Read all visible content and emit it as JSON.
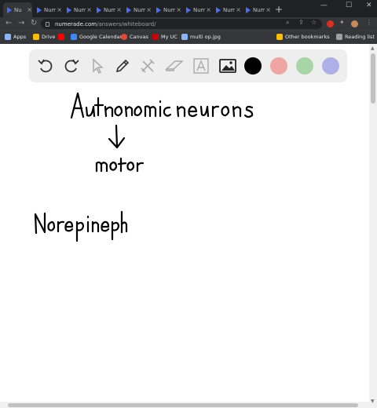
{
  "browser": {
    "tabs": [
      {
        "label": "Nu",
        "active": true
      },
      {
        "label": "Nume"
      },
      {
        "label": "Nume"
      },
      {
        "label": "Nume"
      },
      {
        "label": "Nume"
      },
      {
        "label": "Nume"
      },
      {
        "label": "Nume"
      },
      {
        "label": "Nume"
      },
      {
        "label": "Nume"
      }
    ],
    "new_tab_label": "+",
    "url_host": "numerade.com",
    "url_path": "/answers/whiteboard/",
    "bookmarks": [
      {
        "label": "Apps",
        "color": "#8ab4f8"
      },
      {
        "label": "Drive",
        "color": "#fbbc04"
      },
      {
        "label": "",
        "color": "#ff0000"
      },
      {
        "label": "Google Calendar",
        "color": "#4285f4"
      },
      {
        "label": "Canvas",
        "color": "#e34935"
      },
      {
        "label": "My UC",
        "color": "#c5050c"
      },
      {
        "label": "multi op.jpg",
        "color": "#8ab4f8"
      }
    ],
    "other_bookmarks": "Other bookmarks",
    "reading_list": "Reading list"
  },
  "whiteboard": {
    "tools": [
      "undo-icon",
      "redo-icon",
      "select-icon",
      "pen-icon",
      "tools-icon",
      "eraser-icon",
      "text-icon",
      "image-icon"
    ],
    "colors": [
      "#000000",
      "#f0a5a5",
      "#a8d5a8",
      "#b0b0e8"
    ]
  },
  "handwriting": {
    "line1": "Autonomic neurons",
    "line2": "motor",
    "line3": "Norepineph"
  }
}
